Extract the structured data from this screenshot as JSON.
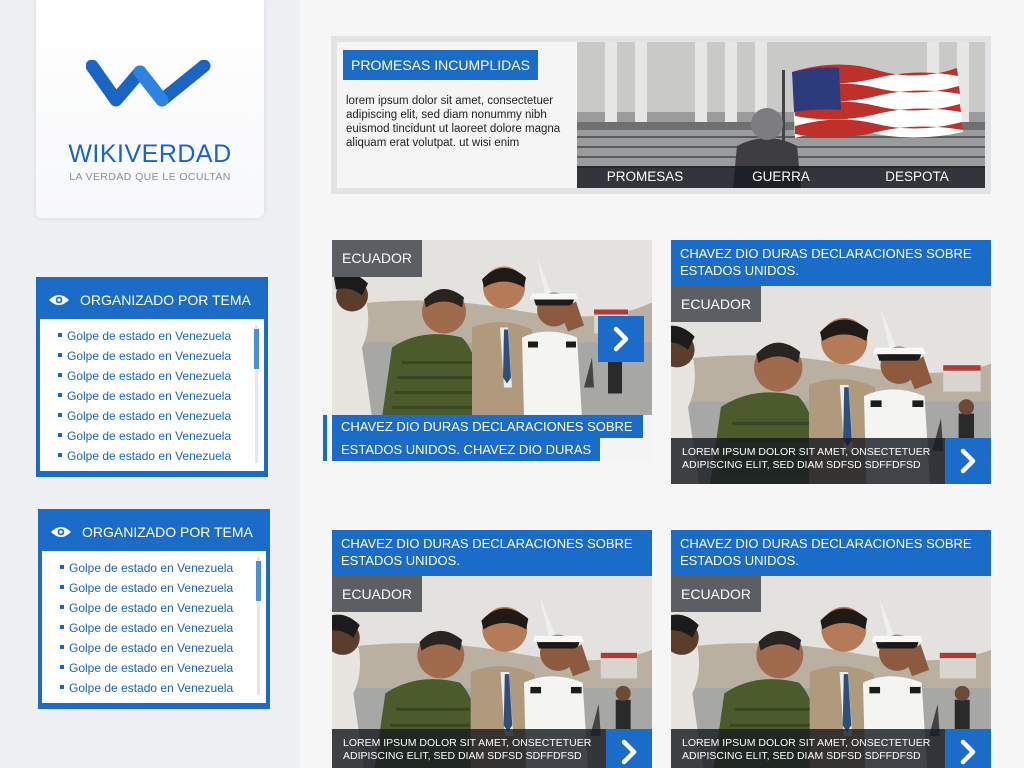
{
  "brand": {
    "title": "WIKIVERDAD",
    "subtitle": "LA VERDAD QUE LE OCULTAN",
    "accent_color": "#1a6cc8"
  },
  "topic_boxes": [
    {
      "heading": "ORGANIZADO POR TEMA",
      "icon": "eye-icon",
      "items": [
        "Golpe de estado en Venezuela",
        "Golpe de estado en Venezuela",
        "Golpe de estado en Venezuela",
        "Golpe de estado en Venezuela",
        "Golpe de estado en Venezuela",
        "Golpe de estado en Venezuela",
        "Golpe de estado en Venezuela"
      ]
    },
    {
      "heading": "ORGANIZADO POR TEMA",
      "icon": "eye-icon",
      "items": [
        "Golpe de estado en Venezuela",
        "Golpe de estado en Venezuela",
        "Golpe de estado en Venezuela",
        "Golpe de estado en Venezuela",
        "Golpe de estado en Venezuela",
        "Golpe de estado en Venezuela",
        "Golpe de estado en Venezuela"
      ]
    }
  ],
  "hero": {
    "tag": "PROMESAS INCUMPLIDAS",
    "description": "lorem ipsum dolor sit amet, consectetuer adipiscing elit, sed diam nonummy nibh euismod tincidunt ut laoreet dolore magna aliquam erat volutpat. ut wisi enim",
    "tabs": [
      "PROMESAS",
      "GUERRA",
      "DESPOTA"
    ]
  },
  "cards": [
    {
      "category": "ECUADOR",
      "title_line1": "CHAVEZ DIO DURAS DECLARACIONES SOBRE",
      "title_line2": "ESTADOS UNIDOS. CHAVEZ DIO DURAS"
    },
    {
      "category": "ECUADOR",
      "title": "CHAVEZ DIO DURAS DECLARACIONES SOBRE ESTADOS UNIDOS.",
      "caption": "LOREM IPSUM DOLOR SIT AMET, ONSECTETUER ADIPISCING ELIT, SED DIAM SDFSD SDFFDFSD"
    },
    {
      "category": "ECUADOR",
      "title": "CHAVEZ DIO DURAS DECLARACIONES SOBRE ESTADOS UNIDOS.",
      "caption": "LOREM IPSUM DOLOR SIT AMET, ONSECTETUER ADIPISCING ELIT, SED DIAM SDFSD SDFFDFSD"
    },
    {
      "category": "ECUADOR",
      "title": "CHAVEZ DIO DURAS DECLARACIONES SOBRE ESTADOS UNIDOS.",
      "caption": "LOREM IPSUM DOLOR SIT AMET, ONSECTETUER ADIPISCING ELIT, SED DIAM SDFSD SDFFDFSD"
    }
  ]
}
